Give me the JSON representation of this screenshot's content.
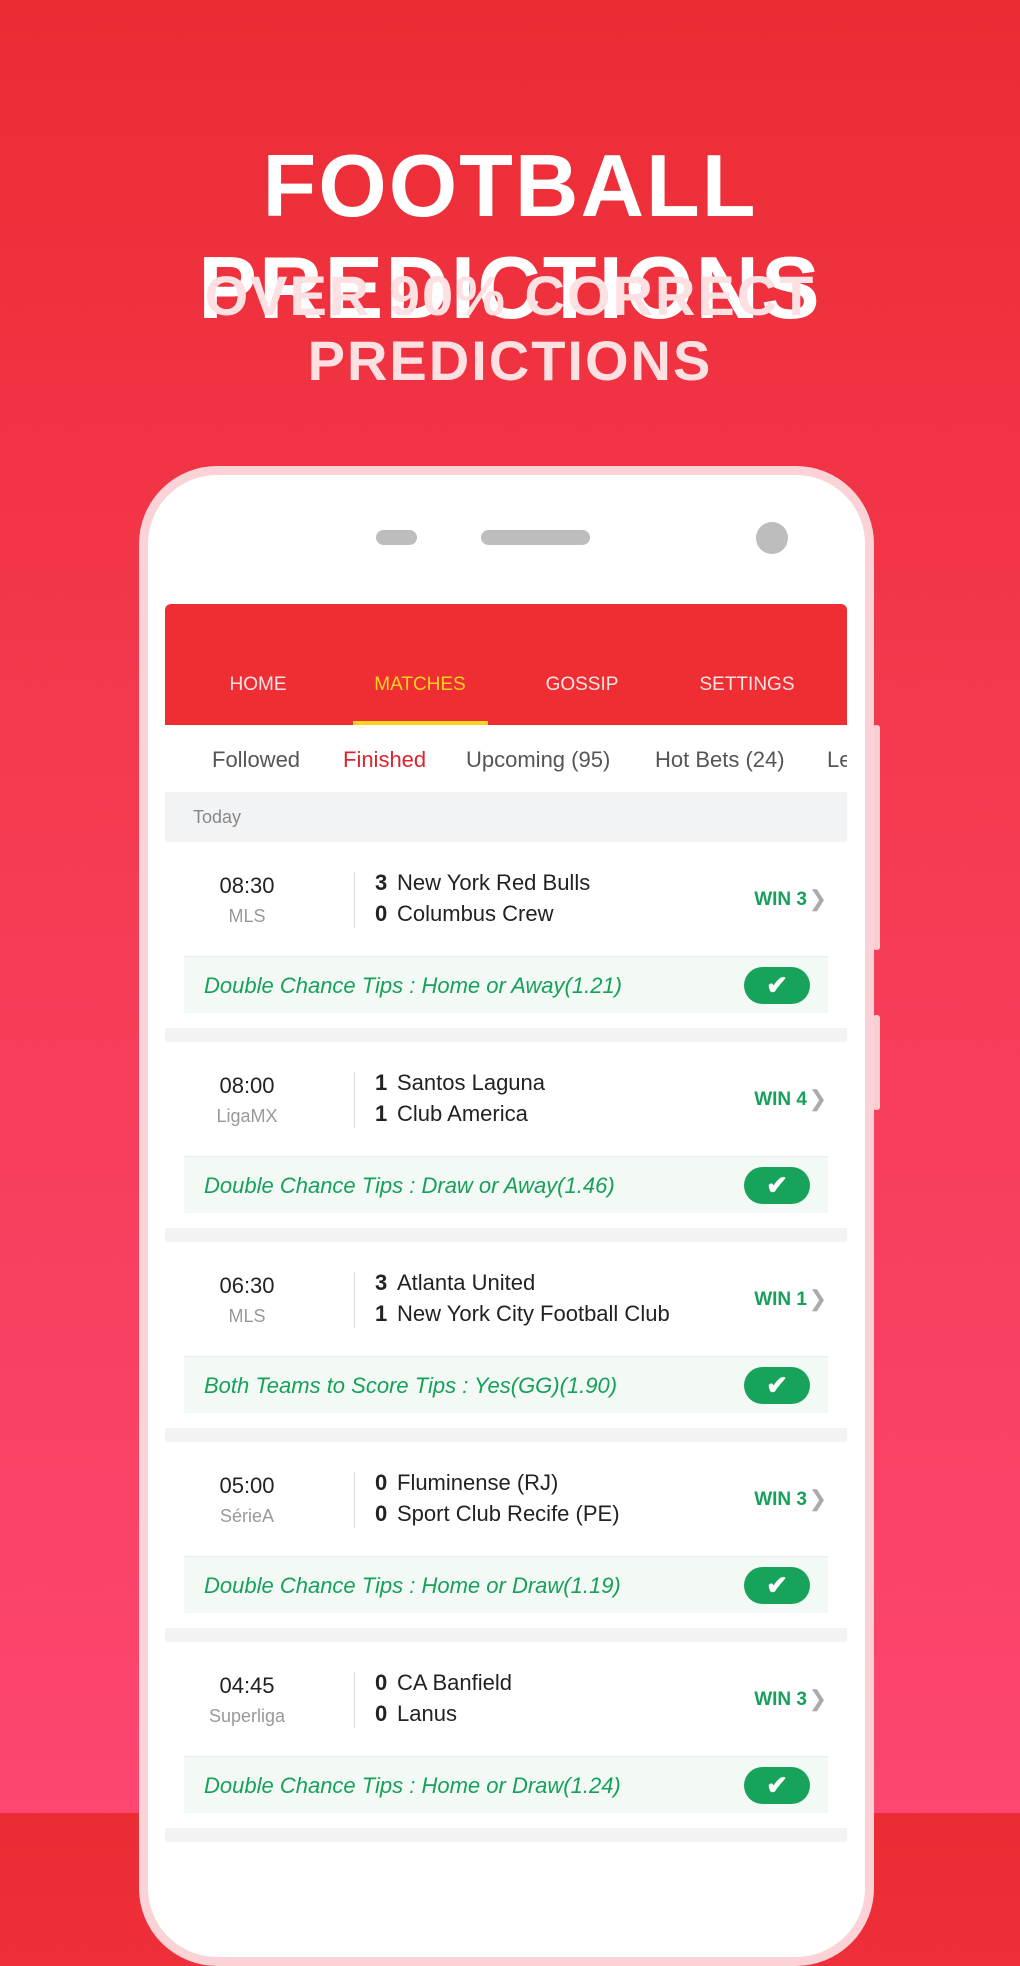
{
  "promo": {
    "title": "FOOTBALL PREDICTIONS",
    "subtitle": "OVER 90% CORRECT PREDICTIONS"
  },
  "nav": {
    "tabs": [
      {
        "label": "HOME"
      },
      {
        "label": "MATCHES"
      },
      {
        "label": "GOSSIP"
      },
      {
        "label": "SETTINGS"
      }
    ],
    "active": "MATCHES"
  },
  "subtabs": [
    {
      "label": "Followed"
    },
    {
      "label": "Finished"
    },
    {
      "label": "Upcoming (95)"
    },
    {
      "label": "Hot Bets (24)"
    },
    {
      "label": "Le"
    }
  ],
  "active_subtab": "Finished",
  "section": "Today",
  "matches": [
    {
      "time": "08:30",
      "league": "MLS",
      "home_score": "3",
      "home": "New York Red Bulls",
      "away_score": "0",
      "away": "Columbus Crew",
      "result": "WIN 3",
      "tip": "Double Chance Tips : Home or Away(1.21)",
      "correct": true
    },
    {
      "time": "08:00",
      "league": "LigaMX",
      "home_score": "1",
      "home": "Santos Laguna",
      "away_score": "1",
      "away": "Club America",
      "result": "WIN 4",
      "tip": "Double Chance Tips : Draw or Away(1.46)",
      "correct": true
    },
    {
      "time": "06:30",
      "league": "MLS",
      "home_score": "3",
      "home": "Atlanta United",
      "away_score": "1",
      "away": "New York City Football Club",
      "result": "WIN 1",
      "tip": "Both Teams to Score Tips : Yes(GG)(1.90)",
      "correct": true
    },
    {
      "time": "05:00",
      "league": "SérieA",
      "home_score": "0",
      "home": "Fluminense (RJ)",
      "away_score": "0",
      "away": "Sport Club Recife (PE)",
      "result": "WIN 3",
      "tip": "Double Chance Tips : Home or Draw(1.19)",
      "correct": true
    },
    {
      "time": "04:45",
      "league": "Superliga",
      "home_score": "0",
      "home": "CA Banfield",
      "away_score": "0",
      "away": "Lanus",
      "result": "WIN 3",
      "tip": "Double Chance Tips : Home or Draw(1.24)",
      "correct": true
    }
  ],
  "colors": {
    "header": "#ee2e33",
    "active_tab": "#ffd21f",
    "active_subtab": "#d8262f",
    "win": "#17a05a"
  }
}
